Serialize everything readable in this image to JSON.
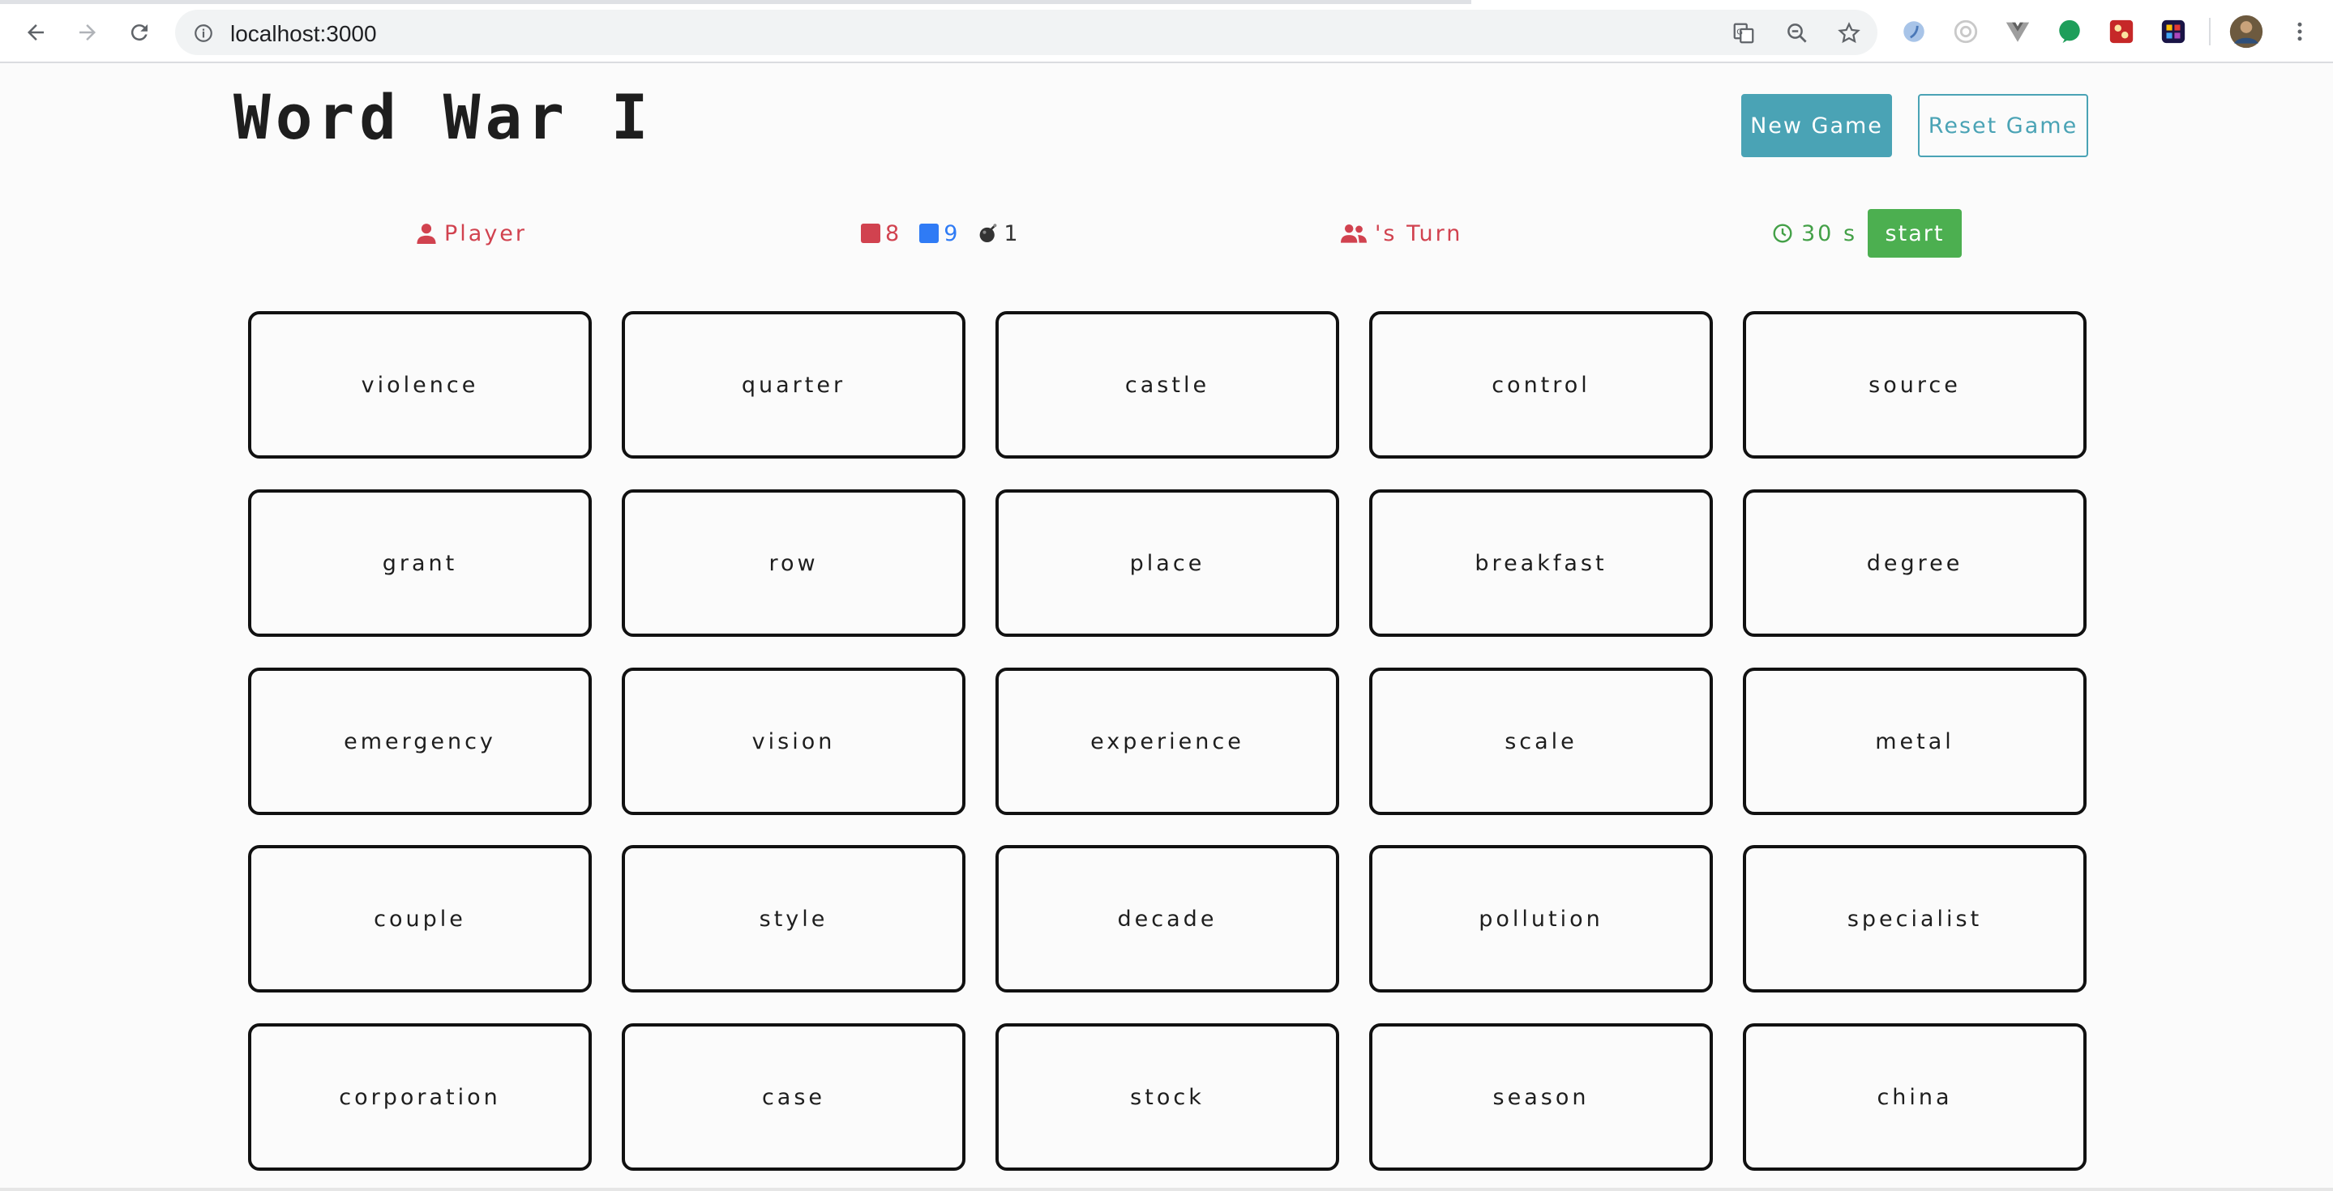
{
  "browser": {
    "url": "localhost:3000"
  },
  "game": {
    "title": "Word War I",
    "new_game_label": "New Game",
    "reset_game_label": "Reset Game",
    "player_label": "Player",
    "red_count": "8",
    "blue_count": "9",
    "bomb_count": "1",
    "turn_label": "'s Turn",
    "timer_label": "30 s",
    "start_label": "start"
  },
  "colors": {
    "red_team": "#d1424f",
    "blue_team": "#2f7bf5",
    "accent": "#4aa3b5",
    "timer_green": "#43a047",
    "start_green": "#4caf50"
  },
  "words": [
    "violence",
    "quarter",
    "castle",
    "control",
    "source",
    "grant",
    "row",
    "place",
    "breakfast",
    "degree",
    "emergency",
    "vision",
    "experience",
    "scale",
    "metal",
    "couple",
    "style",
    "decade",
    "pollution",
    "specialist",
    "corporation",
    "case",
    "stock",
    "season",
    "china"
  ]
}
